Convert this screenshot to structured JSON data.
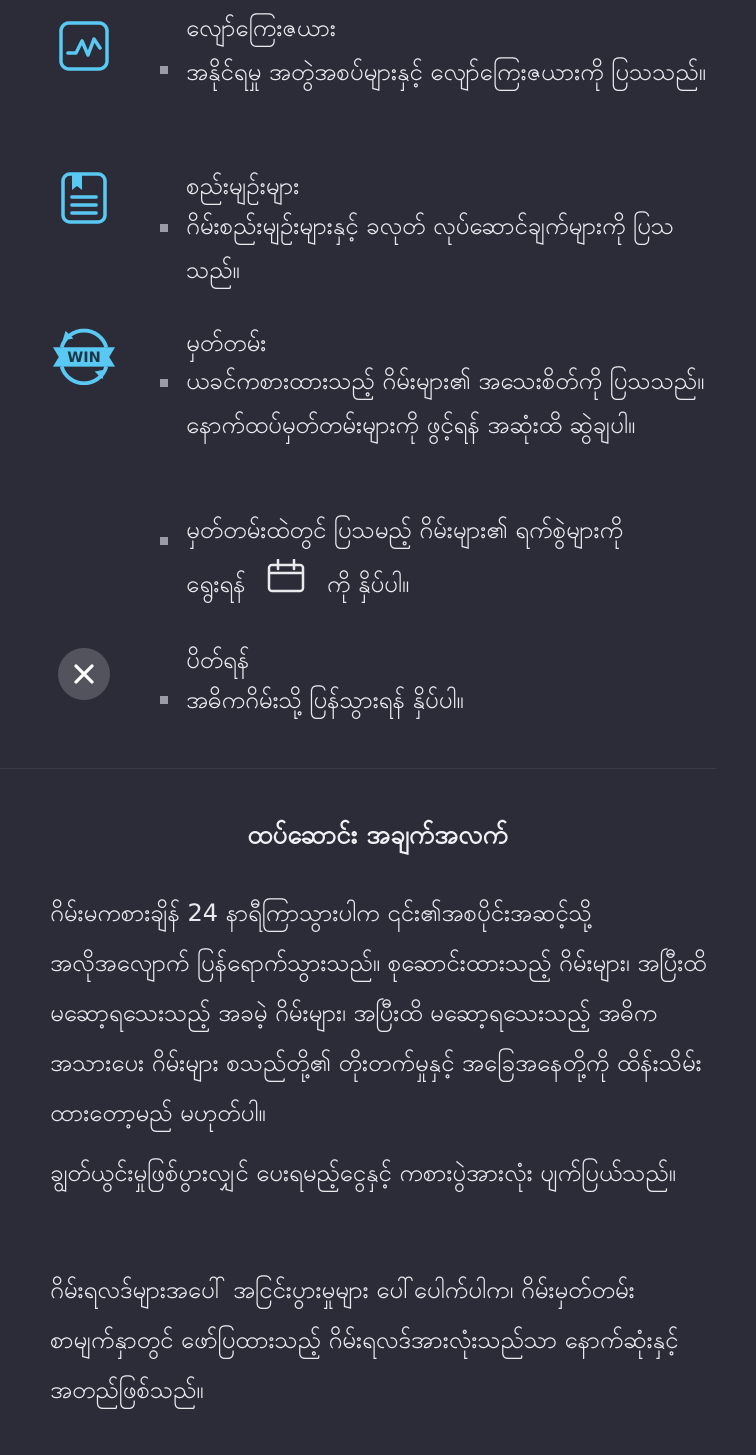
{
  "legend": [
    {
      "heading": "လျော်ကြေးဇယား",
      "bullets": [
        "အနိုင်ရမှု အတွဲအစပ်များနှင့် လျော်ကြေးဇယားကို ပြသသည်။"
      ]
    },
    {
      "heading": "စည်းမျဉ်းများ",
      "bullets": [
        "ဂိမ်းစည်းမျဉ်းများနှင့် ခလုတ် လုပ်ဆောင်ချက်များကို ပြသသည်။"
      ]
    },
    {
      "heading": "မှတ်တမ်း",
      "icon_label": "WIN",
      "bullets": [
        "ယခင်ကစားထားသည့် ဂိမ်းများ၏ အသေးစိတ်ကို ပြသသည်။ နောက်ထပ်မှတ်တမ်းများကို ဖွင့်ရန် အဆုံးထိ ဆွဲချပါ။",
        "မှတ်တမ်းထဲတွင် ပြသမည့် ဂိမ်းများ၏ ရက်စွဲများကို"
      ],
      "bullet2_line2_pre": "ရွေးရန်",
      "bullet2_line2_post": "ကို နှိပ်ပါ။"
    },
    {
      "heading": "ပိတ်ရန်",
      "bullets": [
        "အဓိကဂိမ်းသို့ ပြန်သွားရန် နှိပ်ပါ။"
      ]
    }
  ],
  "additional": {
    "title": "ထပ်ဆောင်း အချက်အလက်",
    "paragraphs": [
      "ဂိမ်းမကစားချိန် 24 နာရီကြာသွားပါက ၎င်း၏အစပိုင်းအဆင့်သို့ အလိုအလျောက် ပြန်ရောက်သွားသည်။ စုဆောင်းထားသည့် ဂိမ်းများ၊ အပြီးထိ မဆော့ရသေးသည့် အခမဲ့ ဂိမ်းများ၊ အပြီးထိ မဆော့ရသေးသည့် အဓိကအသားပေး ဂိမ်းများ စသည်တို့၏ တိုးတက်မှုနှင့် အခြေအနေတို့ကို ထိန်းသိမ်းထားတော့မည် မဟုတ်ပါ။",
      "ချွတ်ယွင်းမှုဖြစ်ပွားလျှင် ပေးရမည့်ငွေနှင့် ကစားပွဲအားလုံး ပျက်ပြယ်သည်။",
      "ဂိမ်းရလဒ်များအပေါ် အငြင်းပွားမှုများ ပေါ်ပေါက်ပါက၊ ဂိမ်းမှတ်တမ်းစာမျက်နှာတွင် ဖော်ပြထားသည့် ဂိမ်းရလဒ်အားလုံးသည်သာ နောက်ဆုံးနှင့် အတည်ဖြစ်သည်။"
    ]
  },
  "colors": {
    "background": "#2b2c38",
    "icon_accent": "#59c8f3",
    "text": "#e9e9ee",
    "bullet": "#9a9ba6"
  },
  "icons": [
    "paytable-chart-icon",
    "rules-document-icon",
    "history-win-icon",
    "calendar-icon",
    "close-icon"
  ]
}
